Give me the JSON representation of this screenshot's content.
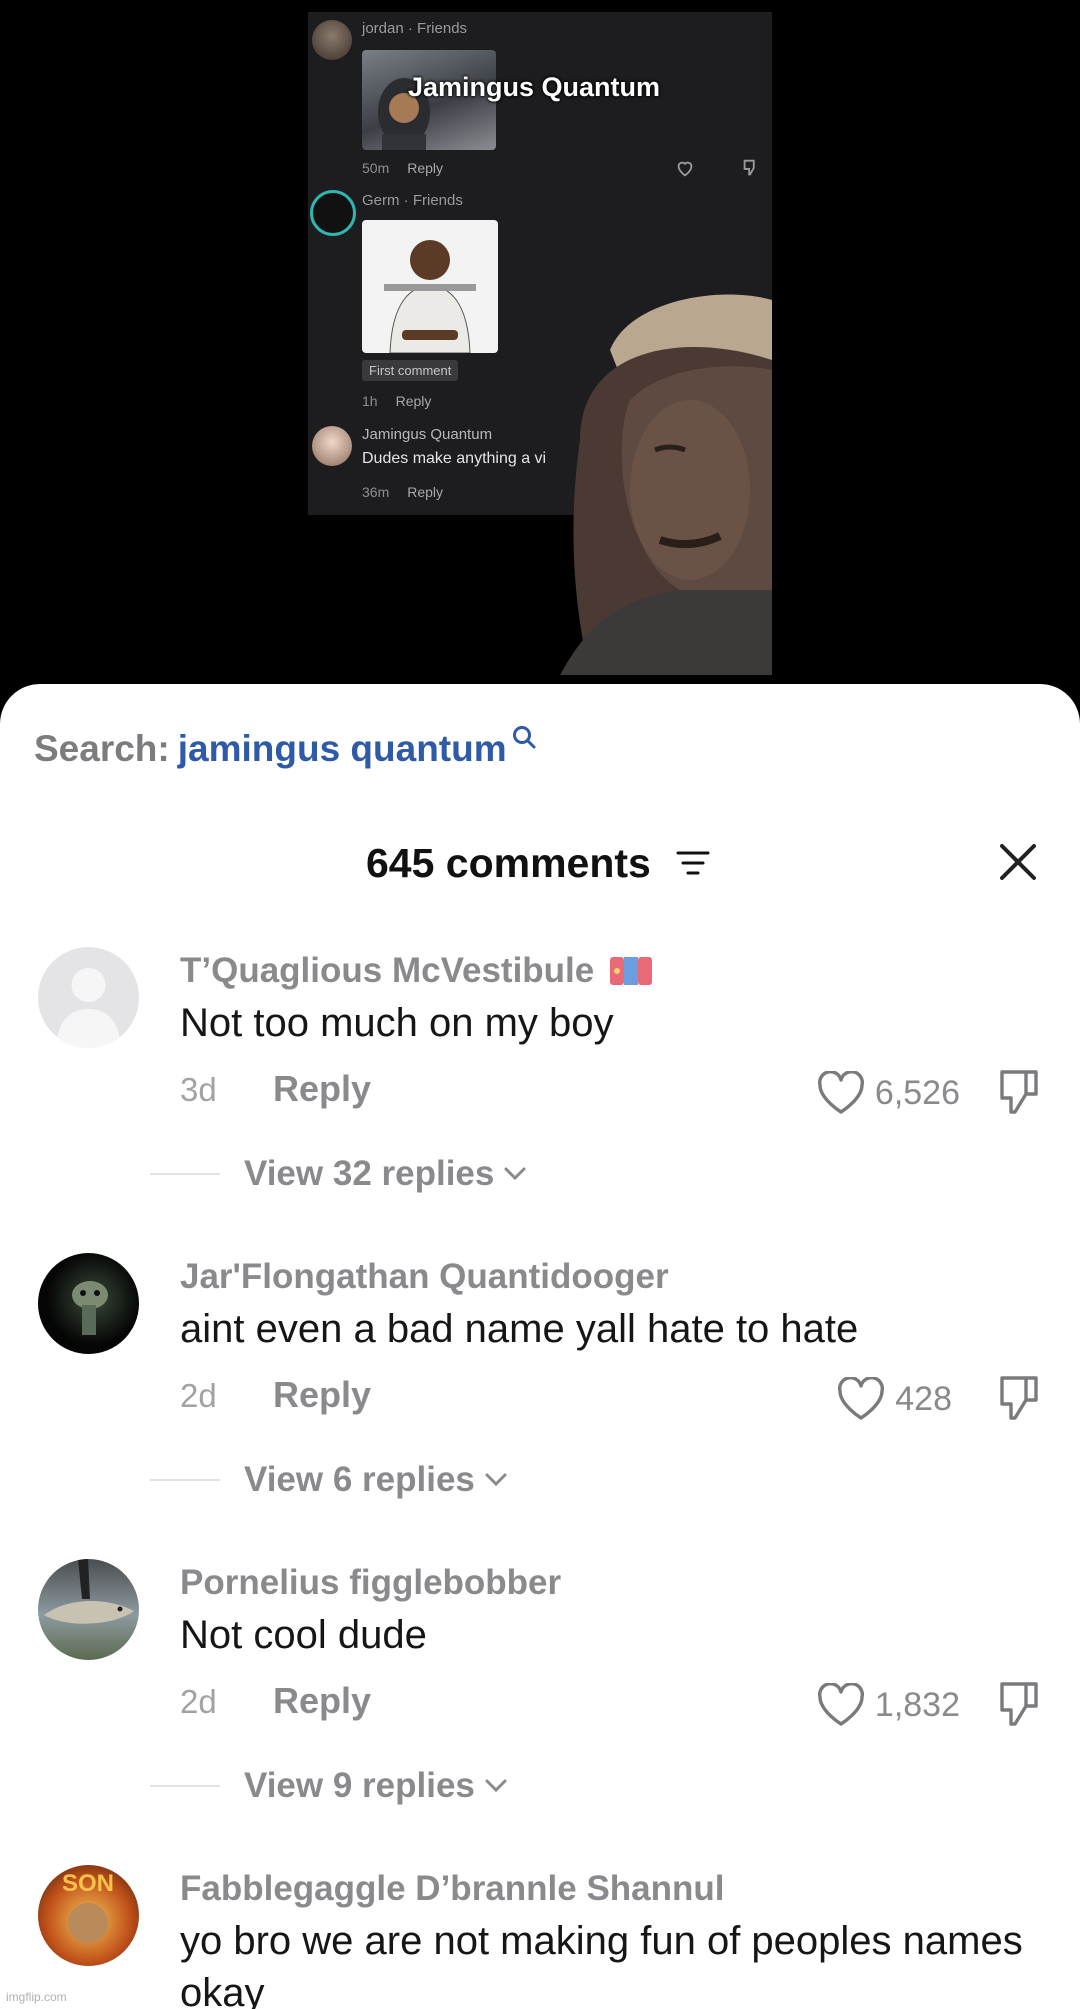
{
  "video": {
    "embedded_comments": [
      {
        "user": "jordan · Friends",
        "image_caption": "Jamingus Quantum",
        "time": "50m",
        "reply": "Reply"
      },
      {
        "user": "Germ · Friends",
        "chip": "First comment",
        "time": "1h",
        "reply": "Reply"
      },
      {
        "user": "Jamingus Quantum",
        "text": "Dudes make anything a vi",
        "time": "36m",
        "reply": "Reply"
      }
    ]
  },
  "sheet": {
    "search_label": "Search:",
    "search_query": "jamingus quantum",
    "comment_count": "645 comments",
    "colors": {
      "accent": "#2e5aa8",
      "muted": "#8a8a8e",
      "text": "#161616"
    }
  },
  "comments": [
    {
      "name": "T’Quaglious McVestibule",
      "text": "Not too much on my boy",
      "time": "3d",
      "reply": "Reply",
      "likes": "6,526",
      "view_replies": "View 32 replies"
    },
    {
      "name": "Jar'Flongathan Quantidooger",
      "text": "aint even a bad name yall hate to hate",
      "time": "2d",
      "reply": "Reply",
      "likes": "428",
      "view_replies": "View 6 replies"
    },
    {
      "name": "Pornelius figglebobber",
      "text": "Not cool dude",
      "time": "2d",
      "reply": "Reply",
      "likes": "1,832",
      "view_replies": "View 9 replies"
    },
    {
      "name": "Fabblegaggle D’brannle Shannul",
      "text": "yo bro we are not making fun of peoples names okay"
    }
  ],
  "watermark": "imgflip.com"
}
